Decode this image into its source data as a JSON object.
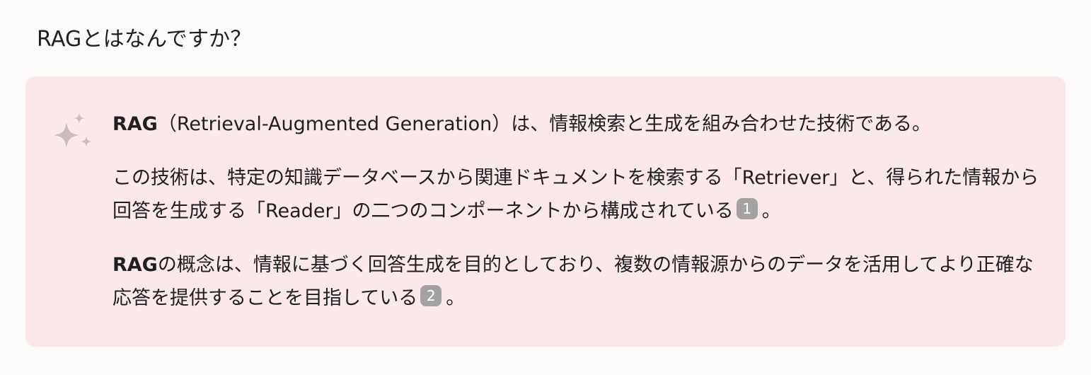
{
  "question": "RAGとはなんですか？",
  "answer": {
    "p1": {
      "bold": "RAG",
      "text": "（Retrieval-Augmented Generation）は、情報検索と生成を組み合わせた技術である。"
    },
    "p2": {
      "text": "この技術は、特定の知識データベースから関連ドキュメントを検索する「Retriever」と、得られた情報から回答を生成する「Reader」の二つのコンポーネントから構成されている",
      "citation": "1",
      "end": "。"
    },
    "p3": {
      "bold": "RAG",
      "text": "の概念は、情報に基づく回答生成を目的としており、複数の情報源からのデータを活用してより正確な応答を提供することを目指している",
      "citation": "2",
      "end": "。"
    }
  },
  "icons": {
    "sparkle": "sparkle-icon"
  },
  "colors": {
    "page_background": "#fdfafa",
    "answer_background": "#fae8ea",
    "sparkle": "#c8bcbe",
    "citation_badge": "#a3a1a1"
  }
}
